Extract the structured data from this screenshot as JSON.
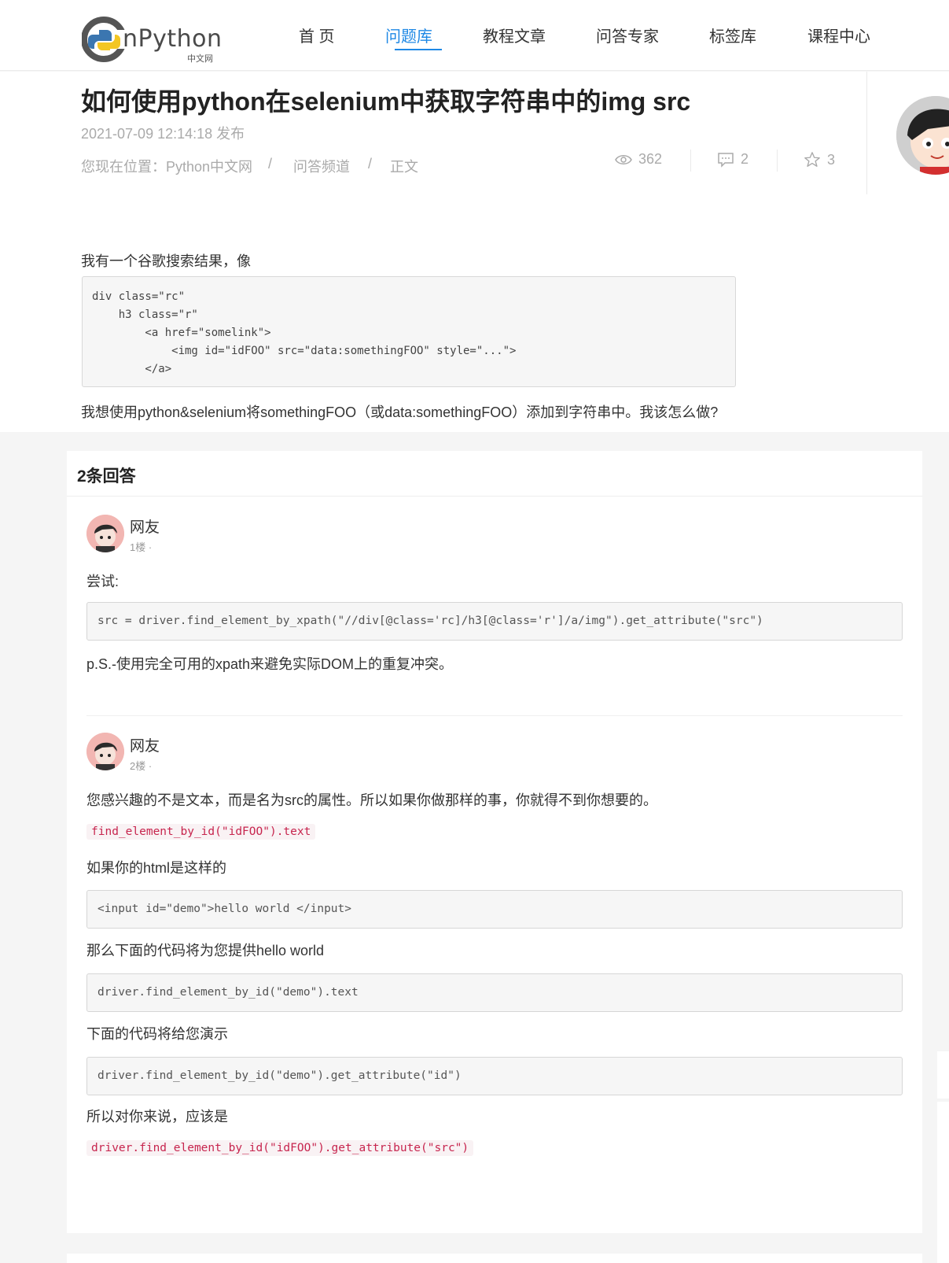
{
  "header": {
    "logo_text": "nPython",
    "logo_sub": "中文网",
    "nav": [
      "首 页",
      "问题库",
      "教程文章",
      "问答专家",
      "标签库",
      "课程中心"
    ],
    "active_index": 1
  },
  "article": {
    "title": "如何使用python在selenium中获取字符串中的img src",
    "date": "2021-07-09 12:14:18 发布",
    "breadcrumb": [
      "您现在位置：Python中文网",
      "/",
      "问答频道",
      "/",
      "正文"
    ],
    "stats": {
      "views": "362",
      "comments": "2",
      "favorites": "3"
    },
    "intro": "我有一个谷歌搜索结果，像",
    "code": "div class=\"rc\"\n    h3 class=\"r\"\n        <a href=\"somelink\">\n            <img id=\"idFOO\" src=\"data:somethingFOO\" style=\"...\">\n        </a>",
    "question": "我想使用python&selenium将somethingFOO（或data:somethingFOO）添加到字符串中。我该怎么做?"
  },
  "answers": {
    "title": "2条回答",
    "items": [
      {
        "user": "网友",
        "floor": "1楼 ·",
        "text1": "尝试:",
        "code1": "src = driver.find_element_by_xpath(\"//div[@class='rc]/h3[@class='r']/a/img\").get_attribute(\"src\")",
        "text2": "p.S.-使用完全可用的xpath来避免实际DOM上的重复冲突。"
      },
      {
        "user": "网友",
        "floor": "2楼 ·",
        "text1": "您感兴趣的不是文本，而是名为src的属性。所以如果你做那样的事，你就得不到你想要的。",
        "inline1": "find_element_by_id(\"idFOO\").text",
        "text2": "如果你的html是这样的",
        "code1": "<input id=\"demo\">hello world </input>",
        "text3": "那么下面的代码将为您提供hello world",
        "code2": "driver.find_element_by_id(\"demo\").text",
        "text4": "下面的代码将给您演示",
        "code3": "driver.find_element_by_id(\"demo\").get_attribute(\"id\")",
        "text5": "所以对你来说，应该是",
        "inline2": "driver.find_element_by_id(\"idFOO\").get_attribute(\"src\")"
      }
    ]
  },
  "colors": {
    "accent": "#1e88e5",
    "inline_code": "#c7254e"
  },
  "icons": [
    "eye-icon",
    "comment-icon",
    "star-icon"
  ]
}
